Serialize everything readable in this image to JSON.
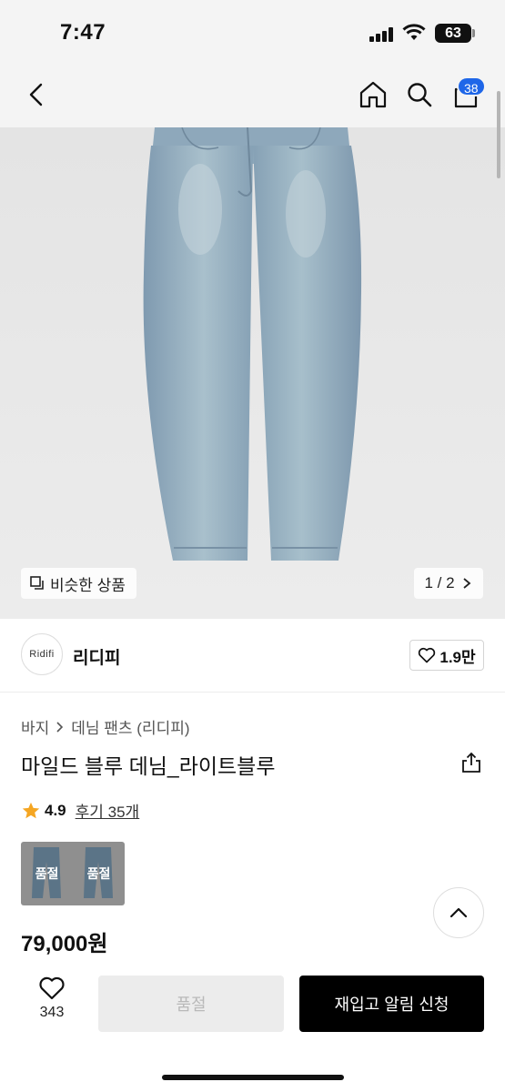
{
  "status_bar": {
    "time": "7:47",
    "battery": "63"
  },
  "header": {
    "cart_count": "38"
  },
  "image": {
    "similar_label": "비슷한 상품",
    "page_indicator": "1 / 2"
  },
  "brand": {
    "logo_text": "Ridifi",
    "name": "리디피",
    "likes": "1.9만"
  },
  "breadcrumb": [
    "바지",
    "데님 팬츠 (리디피)"
  ],
  "product": {
    "title": "마일드 블루 데님_라이트블루",
    "rating": "4.9",
    "review_link": "후기 35개",
    "price": "79,000원"
  },
  "options": [
    {
      "label": "품절"
    },
    {
      "label": "품절"
    }
  ],
  "bottom_bar": {
    "wish_count": "343",
    "soldout_label": "품절",
    "restock_label": "재입고 알림 신청"
  },
  "colors": {
    "accent_badge": "#1e66e8",
    "star": "#f5a623",
    "denim": "#8fa9bd"
  },
  "icons": [
    "back-arrow-icon",
    "home-icon",
    "search-icon",
    "cart-icon",
    "similar-products-icon",
    "chevron-right-icon",
    "heart-icon",
    "share-icon",
    "star-icon",
    "chevron-up-icon"
  ]
}
